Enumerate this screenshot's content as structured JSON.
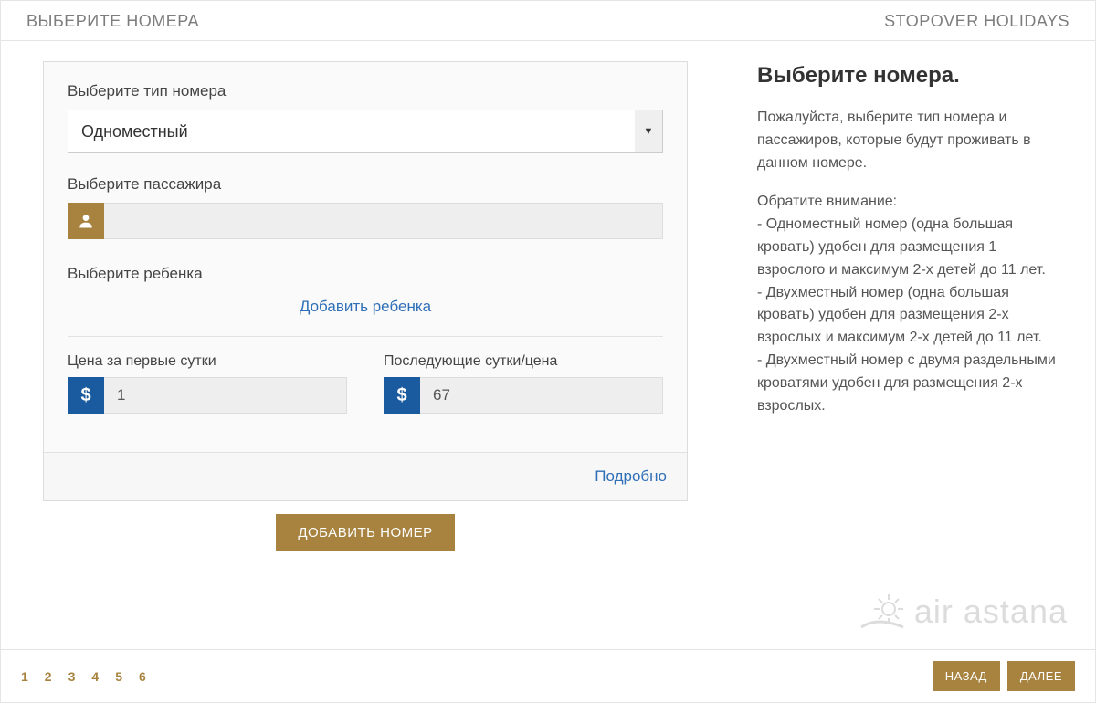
{
  "header": {
    "left": "ВЫБЕРИТЕ НОМЕРА",
    "right": "STOPOVER HOLIDAYS"
  },
  "form": {
    "room_type_label": "Выберите тип номера",
    "room_type_value": "Одноместный",
    "passenger_label": "Выберите пассажира",
    "child_label": "Выберите ребенка",
    "add_child_label": "Добавить ребенка",
    "first_night_label": "Цена за первые сутки",
    "first_night_value": "1",
    "next_night_label": "Последующие сутки/цена",
    "next_night_value": "67",
    "details_label": "Подробно",
    "add_room_label": "ДОБАВИТЬ НОМЕР"
  },
  "sidebar": {
    "title": "Выберите номера.",
    "intro": "Пожалуйста, выберите тип номера и пассажиров, которые будут проживать в данном номере.",
    "note_title": "Обратите внимание:",
    "note1": "- Одноместный номер (одна большая кровать) удобен для размещения 1 взрослого и максимум 2-х детей до 11 лет.",
    "note2": "- Двухместный номер (одна большая кровать) удобен для размещения 2-х взрослых и максимум 2-х детей до 11 лет.",
    "note3": "- Двухместный номер с двумя раздельными кроватями удобен для размещения 2-х взрослых.",
    "logo_text": "air astana"
  },
  "footer": {
    "pages": [
      "1",
      "2",
      "3",
      "4",
      "5",
      "6"
    ],
    "back": "НАЗАД",
    "next": "ДАЛЕЕ"
  },
  "icons": {
    "dollar": "$"
  }
}
